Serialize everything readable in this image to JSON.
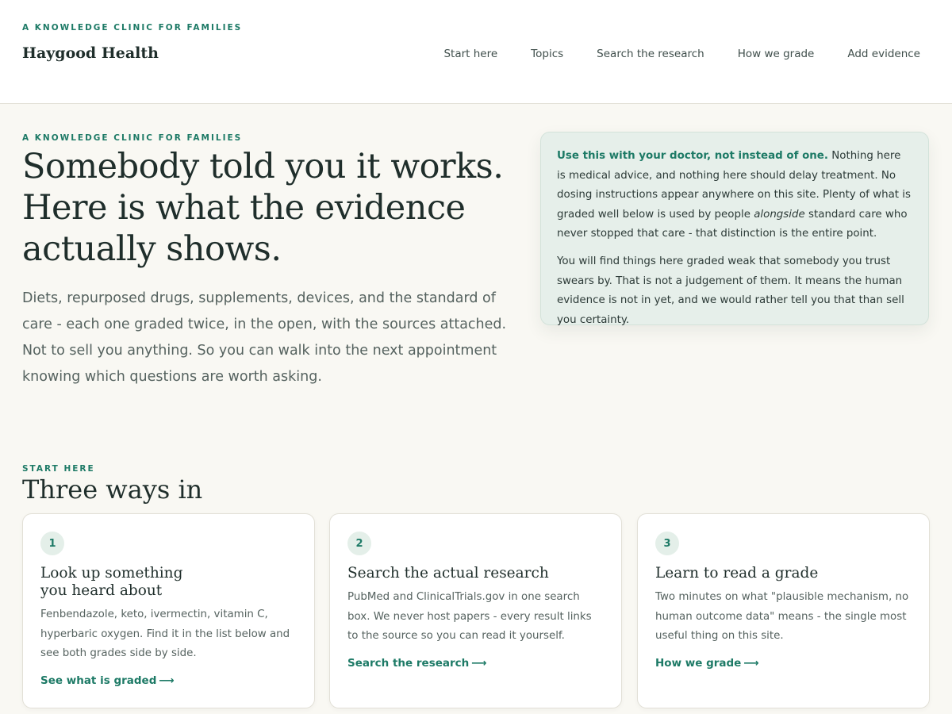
{
  "header": {
    "eyebrow": "A KNOWLEDGE CLINIC FOR FAMILIES",
    "brand": "Haygood Health",
    "nav": [
      "Start here",
      "Topics",
      "Search the research",
      "How we grade",
      "Add evidence"
    ]
  },
  "hero": {
    "eyebrow": "A KNOWLEDGE CLINIC FOR FAMILIES",
    "title": "Somebody told you it works. Here is what the evidence actually shows.",
    "lede": "Diets, repurposed drugs, supplements, devices, and the standard of care - each one graded twice, in the open, with the sources attached. Not to sell you anything. So you can walk into the next appointment knowing which questions are worth asking."
  },
  "notice": {
    "lead": "Use this with your doctor, not instead of one.",
    "p1_a": " Nothing here is medical advice, and nothing here should delay treatment. No dosing instructions appear anywhere on this site. Plenty of what is graded well below is used by people ",
    "p1_em": "alongside",
    "p1_b": " standard care who never stopped that care - that distinction is the entire point.",
    "p2": "You will find things here graded weak that somebody you trust swears by. That is not a judgement of them. It means the human evidence is not in yet, and we would rather tell you that than sell you certainty."
  },
  "section": {
    "eyebrow": "START HERE",
    "title": "Three ways in"
  },
  "cards": [
    {
      "number": "1",
      "title": "Look up something you heard about",
      "body": "Fenbendazole, keto, ivermectin, vitamin C, hyperbaric oxygen. Find it in the list below and see both grades side by side.",
      "link": "See what is graded"
    },
    {
      "number": "2",
      "title": "Search the actual research",
      "body": "PubMed and ClinicalTrials.gov in one search box. We never host papers - every result links to the source so you can read it yourself.",
      "link": "Search the research"
    },
    {
      "number": "3",
      "title": "Learn to read a grade",
      "body": "Two minutes on what \"plausible mechanism, no human outcome data\" means - the single most useful thing on this site.",
      "link": "How we grade"
    }
  ],
  "icons": {
    "link_arrow": "arrow-right-icon"
  },
  "colors": {
    "accent": "#1d7a66",
    "background": "#f9f8f3",
    "notice_bg": "#e6efea"
  }
}
